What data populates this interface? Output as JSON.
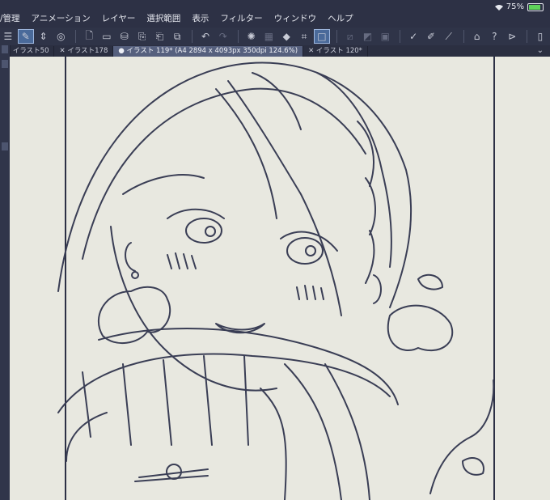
{
  "menu": {
    "items": [
      "/管理",
      "アニメーション",
      "レイヤー",
      "選択範囲",
      "表示",
      "フィルター",
      "ウィンドウ",
      "ヘルプ"
    ]
  },
  "status": {
    "battery": "75%"
  },
  "tabs": [
    {
      "label": "イラスト50",
      "active": false
    },
    {
      "label": "イラスト178",
      "active": false
    },
    {
      "label": "イラスト 119* (A4 2894 x 4093px 350dpi 124.6%)",
      "active": true
    },
    {
      "label": "イラスト 120*",
      "active": false
    }
  ],
  "toolbar": {
    "icons": [
      "menu-icon",
      "edit-icon",
      "spinner-icon",
      "target-icon",
      "new-file-icon",
      "open-folder-icon",
      "save-icon",
      "export-icon",
      "import-icon",
      "layer-icon",
      "undo-icon",
      "redo-icon",
      "lasso-icon",
      "select-all-icon",
      "fill-icon",
      "crop-icon",
      "rect-select-icon",
      "deselect-icon",
      "invert-icon",
      "border-icon",
      "pen-check-icon",
      "brush-icon",
      "ruler-icon",
      "hat-icon",
      "help-icon",
      "flip-icon",
      "device-icon"
    ]
  },
  "colors": {
    "accent": "#4a6a9a",
    "canvas": "#e8e8e0",
    "ink": "#3a3e55"
  }
}
